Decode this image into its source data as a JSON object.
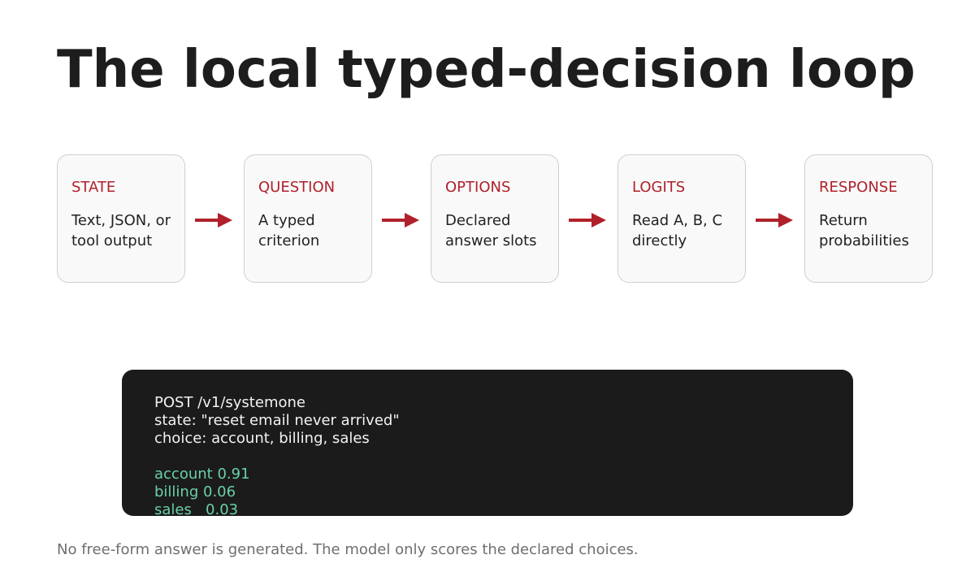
{
  "title": "The local typed-decision loop",
  "colors": {
    "accent": "#b0212b",
    "result": "#6ad0a6",
    "code_background": "#1b1b1b"
  },
  "steps": [
    {
      "label": "STATE",
      "description": "Text, JSON, or tool output"
    },
    {
      "label": "QUESTION",
      "description": "A typed criterion"
    },
    {
      "label": "OPTIONS",
      "description": "Declared answer slots"
    },
    {
      "label": "LOGITS",
      "description": "Read A, B, C directly"
    },
    {
      "label": "RESPONSE",
      "description": "Return probabilities"
    }
  ],
  "arrow_icon": "right-arrow-icon",
  "code": {
    "request": [
      "POST /v1/systemone",
      "state: \"reset email never arrived\"",
      "choice: account, billing, sales"
    ],
    "results": [
      {
        "label": "account",
        "score": "0.91"
      },
      {
        "label": "billing",
        "score": "0.06"
      },
      {
        "label": "sales",
        "score": "0.03"
      }
    ]
  },
  "footnote": "No free-form answer is generated. The model only scores the declared choices."
}
